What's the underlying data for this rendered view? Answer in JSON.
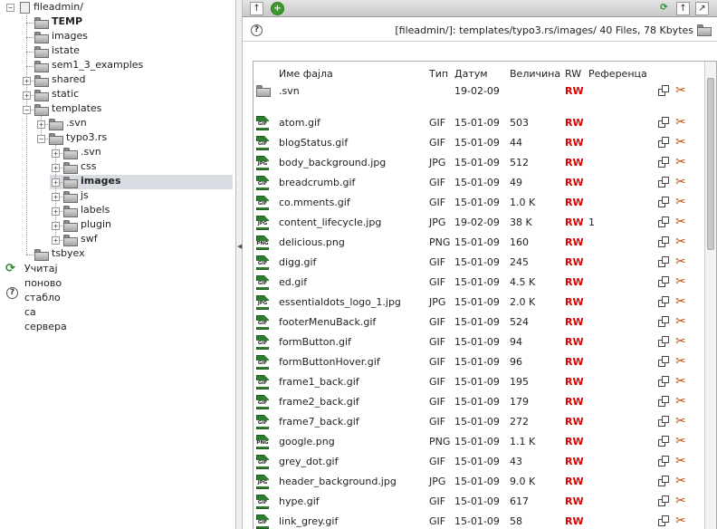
{
  "tree": {
    "root_label": "fileadmin/",
    "items": [
      {
        "label": "TEMP",
        "bold": true
      },
      {
        "label": "images"
      },
      {
        "label": "istate"
      },
      {
        "label": "sem1_3_examples"
      },
      {
        "label": "shared"
      },
      {
        "label": "static"
      },
      {
        "label": "templates"
      },
      {
        "label": ".svn"
      },
      {
        "label": "typo3.rs"
      },
      {
        "label": ".svn"
      },
      {
        "label": "css"
      },
      {
        "label": "images",
        "bold": true
      },
      {
        "label": "js"
      },
      {
        "label": "labels"
      },
      {
        "label": "plugin"
      },
      {
        "label": "swf"
      },
      {
        "label": "tsbyex"
      }
    ],
    "reload_label": "Учитај поново стабло са сервера"
  },
  "path_bar": {
    "text": "[fileadmin/]: templates/typo3.rs/images/ 40 Files, 78 Kbytes"
  },
  "columns": {
    "name": "Име фајла",
    "type": "Тип",
    "date": "Датум",
    "size": "Величина",
    "rw": "RW",
    "refs": "Референца"
  },
  "folder_row": {
    "name": ".svn",
    "date": "19-02-09",
    "rw": "RW"
  },
  "files": [
    {
      "name": "atom.gif",
      "type": "GIF",
      "date": "15-01-09",
      "size": "503",
      "rw": "RW",
      "ref": ""
    },
    {
      "name": "blogStatus.gif",
      "type": "GIF",
      "date": "15-01-09",
      "size": "44",
      "rw": "RW",
      "ref": ""
    },
    {
      "name": "body_background.jpg",
      "type": "JPG",
      "date": "15-01-09",
      "size": "512",
      "rw": "RW",
      "ref": ""
    },
    {
      "name": "breadcrumb.gif",
      "type": "GIF",
      "date": "15-01-09",
      "size": "49",
      "rw": "RW",
      "ref": ""
    },
    {
      "name": "co.mments.gif",
      "type": "GIF",
      "date": "15-01-09",
      "size": "1.0 K",
      "rw": "RW",
      "ref": ""
    },
    {
      "name": "content_lifecycle.jpg",
      "type": "JPG",
      "date": "19-02-09",
      "size": "38 K",
      "rw": "RW",
      "ref": "1"
    },
    {
      "name": "delicious.png",
      "type": "PNG",
      "date": "15-01-09",
      "size": "160",
      "rw": "RW",
      "ref": ""
    },
    {
      "name": "digg.gif",
      "type": "GIF",
      "date": "15-01-09",
      "size": "245",
      "rw": "RW",
      "ref": ""
    },
    {
      "name": "ed.gif",
      "type": "GIF",
      "date": "15-01-09",
      "size": "4.5 K",
      "rw": "RW",
      "ref": ""
    },
    {
      "name": "essentialdots_logo_1.jpg",
      "type": "JPG",
      "date": "15-01-09",
      "size": "2.0 K",
      "rw": "RW",
      "ref": ""
    },
    {
      "name": "footerMenuBack.gif",
      "type": "GIF",
      "date": "15-01-09",
      "size": "524",
      "rw": "RW",
      "ref": ""
    },
    {
      "name": "formButton.gif",
      "type": "GIF",
      "date": "15-01-09",
      "size": "94",
      "rw": "RW",
      "ref": ""
    },
    {
      "name": "formButtonHover.gif",
      "type": "GIF",
      "date": "15-01-09",
      "size": "96",
      "rw": "RW",
      "ref": ""
    },
    {
      "name": "frame1_back.gif",
      "type": "GIF",
      "date": "15-01-09",
      "size": "195",
      "rw": "RW",
      "ref": ""
    },
    {
      "name": "frame2_back.gif",
      "type": "GIF",
      "date": "15-01-09",
      "size": "179",
      "rw": "RW",
      "ref": ""
    },
    {
      "name": "frame7_back.gif",
      "type": "GIF",
      "date": "15-01-09",
      "size": "272",
      "rw": "RW",
      "ref": ""
    },
    {
      "name": "google.png",
      "type": "PNG",
      "date": "15-01-09",
      "size": "1.1 K",
      "rw": "RW",
      "ref": ""
    },
    {
      "name": "grey_dot.gif",
      "type": "GIF",
      "date": "15-01-09",
      "size": "43",
      "rw": "RW",
      "ref": ""
    },
    {
      "name": "header_background.jpg",
      "type": "JPG",
      "date": "15-01-09",
      "size": "9.0 K",
      "rw": "RW",
      "ref": ""
    },
    {
      "name": "hype.gif",
      "type": "GIF",
      "date": "15-01-09",
      "size": "617",
      "rw": "RW",
      "ref": ""
    },
    {
      "name": "link_grey.gif",
      "type": "GIF",
      "date": "15-01-09",
      "size": "58",
      "rw": "RW",
      "ref": ""
    }
  ],
  "icons": {
    "copy": "copy-icon",
    "cut": "scissors-icon",
    "folder": "folder-icon",
    "reload": "reload-icon",
    "help": "help-icon"
  },
  "colors": {
    "rw": "#dd0000",
    "selected_row": "#d9dde3",
    "file_icon": "#2e7d2e"
  }
}
